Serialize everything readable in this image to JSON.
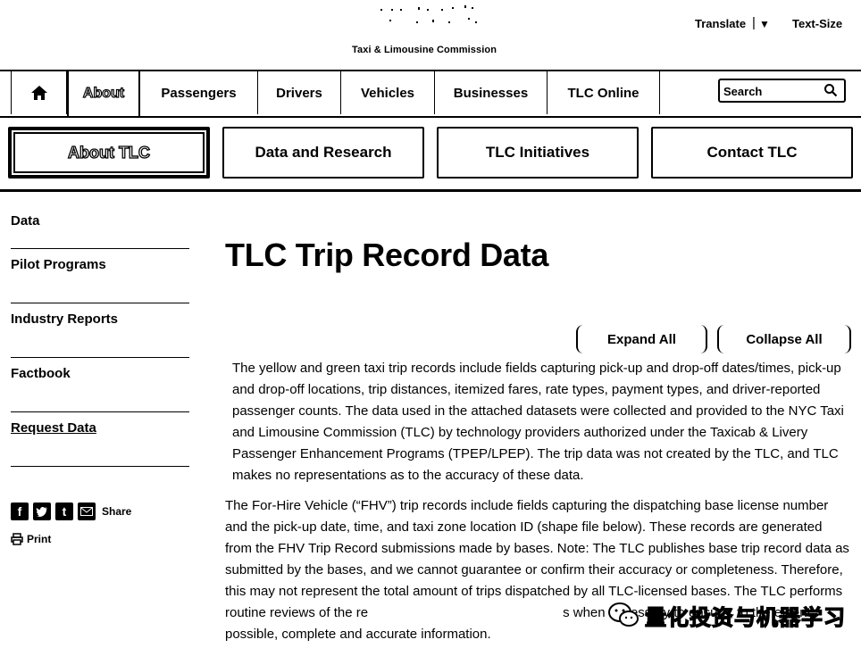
{
  "header": {
    "agency": "Taxi & Limousine Commission",
    "translate": "Translate",
    "separator": "|",
    "caret": "▼",
    "text_size": "Text-Size"
  },
  "nav": {
    "home_icon": "home-icon",
    "items": [
      "About",
      "Passengers",
      "Drivers",
      "Vehicles",
      "Businesses",
      "TLC Online"
    ],
    "search_placeholder": "Search"
  },
  "subnav": [
    "About TLC",
    "Data and Research",
    "TLC Initiatives",
    "Contact TLC"
  ],
  "sidebar": {
    "items": [
      "Data",
      "Pilot Programs",
      "Industry Reports",
      "Factbook",
      "Request Data"
    ],
    "share": "Share",
    "print": "Print"
  },
  "main": {
    "title": "TLC Trip Record Data",
    "expand_all": "Expand All",
    "collapse_all": "Collapse All",
    "p1": "The yellow and green taxi trip records include fields capturing pick-up and drop-off dates/times, pick-up and drop-off locations, trip distances, itemized fares, rate types, payment types, and driver-reported passenger counts. The data used in the attached datasets were collected and provided to the NYC Taxi and Limousine Commission (TLC) by technology providers authorized under the Taxicab & Livery Passenger Enhancement Programs (TPEP/LPEP). The trip data was not created by the TLC, and TLC makes no representations as to the accuracy of these data.",
    "p2_a": "The For-Hire Vehicle (“FHV”) trip records include fields capturing the dispatching base license number and the pick-up date, time, and taxi zone location ID (shape file below). These records are generated from the FHV Trip Record submissions made by bases. Note: The TLC publishes base trip record data as submitted by the bases, and we cannot guarantee or confirm their accuracy or completeness. Therefore, this may not represent the total amount of trips dispatched by all TLC-licensed bases. The TLC performs routine reviews of the re",
    "p2_b": "s when necessary to ensure, to the extent possible, complete and accurate information."
  },
  "watermark": "量化投资与机器学习"
}
